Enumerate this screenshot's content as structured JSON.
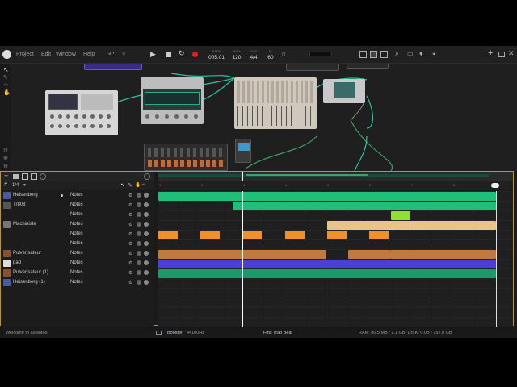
{
  "menu": {
    "project": "Project",
    "edit": "Edit",
    "window": "Window",
    "help": "Help"
  },
  "transport": {
    "bars_label": "BARS",
    "bars_value": "005.01",
    "bpm_label": "BPM",
    "bpm_value": "120",
    "sign_label": "SIGN",
    "sign_value": "4/4",
    "grid_label": "⅟₈",
    "grid_value": "60"
  },
  "sequencer": {
    "quantize": "1/4"
  },
  "tracks": [
    {
      "name": "Heisenberg",
      "notes": "Notes",
      "color": "#4a5aa0"
    },
    {
      "name": "Tr808",
      "notes": "Notes",
      "color": "#555"
    },
    {
      "name": "",
      "notes": "Notes",
      "color": ""
    },
    {
      "name": "Machiniste",
      "notes": "Notes",
      "color": "#777"
    },
    {
      "name": "",
      "notes": "Notes",
      "color": ""
    },
    {
      "name": "",
      "notes": "Notes",
      "color": ""
    },
    {
      "name": "Pulverisateur",
      "notes": "Notes",
      "color": "#8a5030"
    },
    {
      "name": "pad",
      "notes": "Notes",
      "color": "#ddd"
    },
    {
      "name": "Pulverisateur (1)",
      "notes": "Notes",
      "color": "#8a5030"
    },
    {
      "name": "Heisenberg (1)",
      "notes": "Notes",
      "color": "#4a5aa0"
    }
  ],
  "timeline": {
    "markers": [
      "1",
      "2",
      "3",
      "4",
      "5",
      "6",
      "7",
      "8"
    ]
  },
  "colors": {
    "accent": "#c8901e",
    "green": "#1fbf7a",
    "orange": "#f0902a",
    "tan": "#e8c48a",
    "brown": "#c07a40",
    "blue": "#4a3fd8",
    "lime": "#8ee033"
  },
  "status": {
    "welcome": "Welcome to audiotool",
    "booster": "Booster",
    "rate": "44100Hz",
    "project": "First Trap Beat",
    "resources": "RAM: 80.5 MB / 2.1 GB, DISK: 0.0B / 152.0 GB"
  }
}
